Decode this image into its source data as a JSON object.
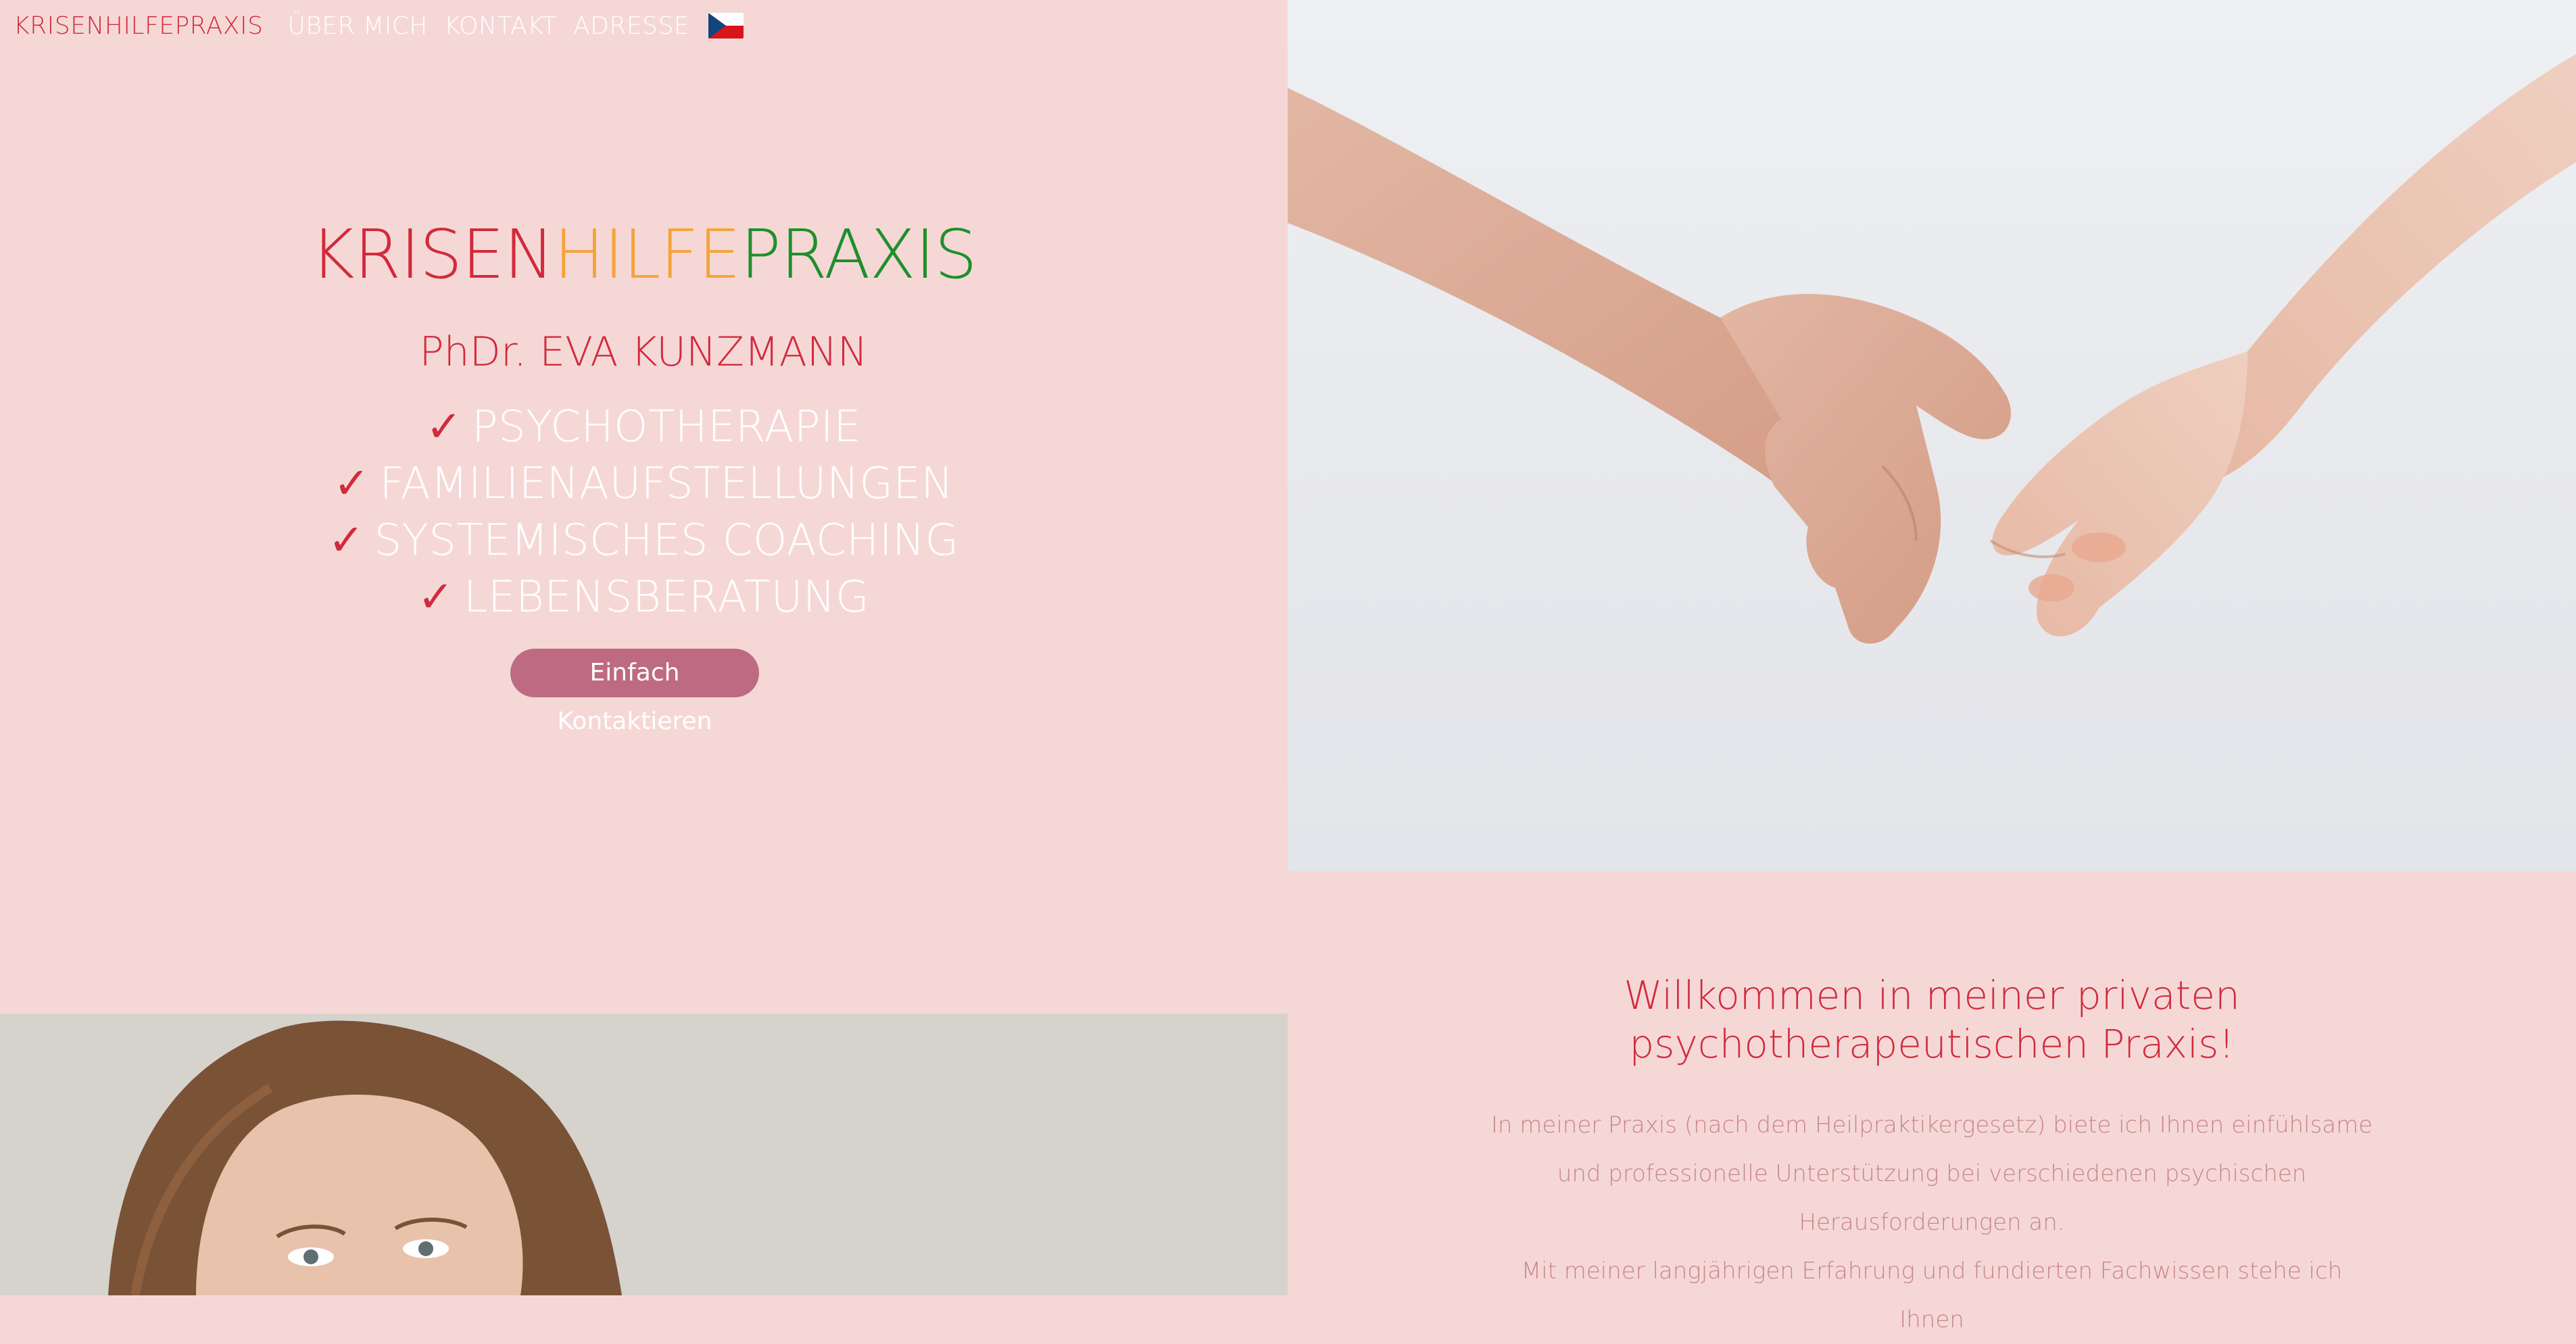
{
  "nav": {
    "brand": "KRISENHILFEPRAXIS",
    "links": [
      "ÜBER MICH",
      "KONTAKT",
      "ADRESSE"
    ],
    "flag_icon": "czech-flag-icon"
  },
  "hero": {
    "logo": {
      "part1": "KRISEN",
      "part2": "HILFE",
      "part3": "PRAXIS"
    },
    "doctor": "PhDr. EVA KUNZMANN",
    "services": [
      "PSYCHOTHERAPIE",
      "FAMILIENAUFSTELLUNGEN",
      "SYSTEMISCHES COACHING",
      "LEBENSBERATUNG"
    ],
    "check_mark": "✓",
    "cta": "Einfach Kontaktieren"
  },
  "welcome": {
    "title_line1": "Willkommen in meiner privaten",
    "title_line2": "psychotherapeutischen Praxis!",
    "lines": [
      "In meiner Praxis (nach dem Heilpraktikergesetz) biete ich Ihnen einfühlsame",
      "und professionelle Unterstützung bei verschiedenen psychischen",
      "Herausforderungen an.",
      "Mit meiner langjährigen Erfahrung und fundierten Fachwissen stehe ich Ihnen"
    ]
  },
  "colors": {
    "background": "#f5d8d6",
    "red": "#d22a3c",
    "orange": "#f4a43a",
    "green": "#1f8f2c",
    "button": "#bd6a82"
  }
}
